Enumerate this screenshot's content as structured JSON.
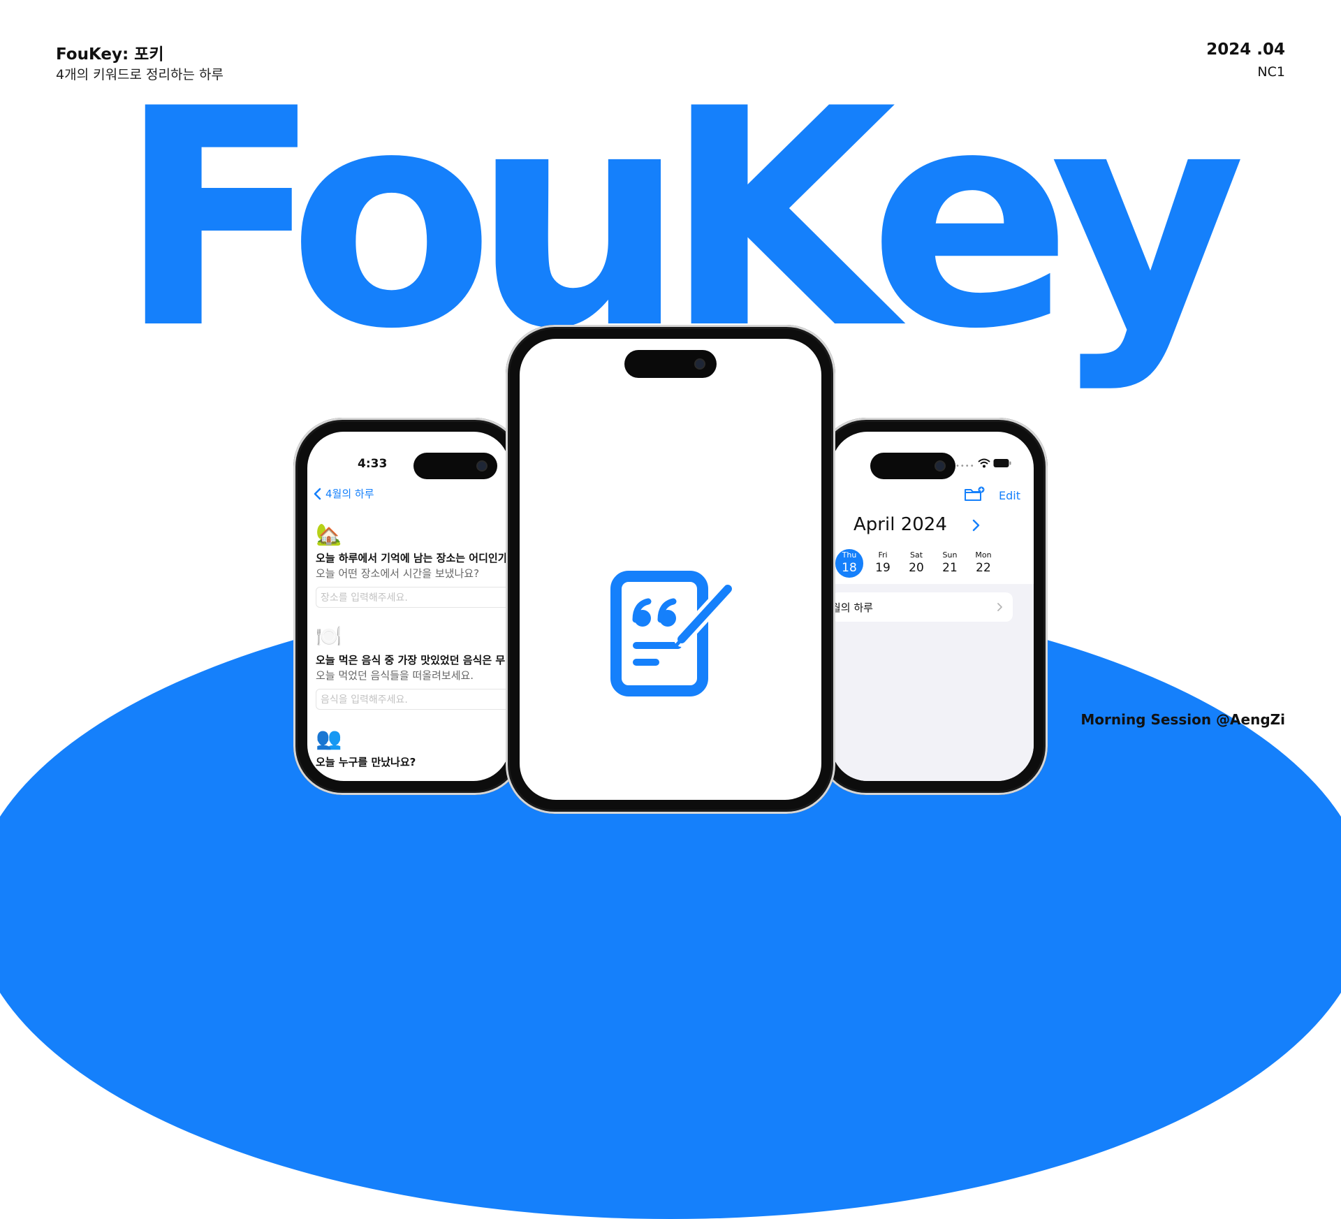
{
  "header": {
    "title": "FouKey: 포키",
    "subtitle": "4개의 키워드로 정리하는 하루",
    "date": "2024 .04",
    "code": "NC1"
  },
  "hero": {
    "word": "FouKey"
  },
  "footer": {
    "session": "Morning Session @AengZi"
  },
  "colors": {
    "accent": "#1580fb",
    "background": "#ffffff"
  },
  "left_phone": {
    "time": "4:33",
    "back_label": "4월의 하루",
    "questions": [
      {
        "icon": "🏡",
        "title": "오늘 하루에서 기억에 남는 장소는 어디인가",
        "sub": "오늘 어떤 장소에서 시간을 보냈나요?",
        "placeholder": "장소를 입력해주세요."
      },
      {
        "icon": "🍽️",
        "title": "오늘 먹은 음식 중 가장 맛있었던 음식은 무",
        "sub": "오늘 먹었던 음식들을 떠올려보세요.",
        "placeholder": "음식을 입력해주세요."
      },
      {
        "icon": "👥",
        "title": "오늘 누구를 만났나요?"
      }
    ]
  },
  "right_phone": {
    "edit_label": "Edit",
    "month_title": "April 2024",
    "days": [
      {
        "name": "Thu",
        "num": "18",
        "selected": true
      },
      {
        "name": "Fri",
        "num": "19"
      },
      {
        "name": "Sat",
        "num": "20"
      },
      {
        "name": "Sun",
        "num": "21"
      },
      {
        "name": "Mon",
        "num": "22"
      }
    ],
    "entry_label": "월의 하루"
  },
  "icons": {
    "app_logo": "quote-note-pencil-icon",
    "back": "chevron-left-icon",
    "next": "chevron-right-icon",
    "folder": "folder-add-icon",
    "wifi": "wifi-icon",
    "battery": "battery-icon"
  }
}
